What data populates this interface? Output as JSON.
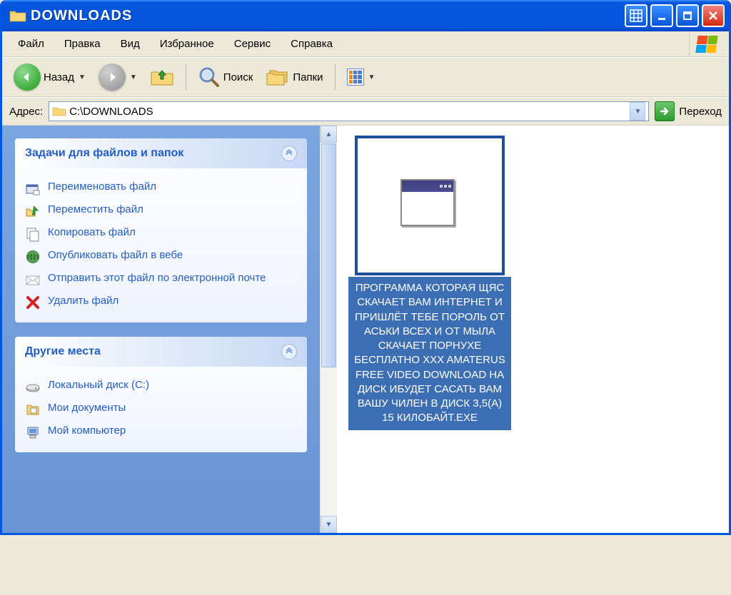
{
  "title": "DOWNLOADS",
  "menu": {
    "file": "Файл",
    "edit": "Правка",
    "view": "Вид",
    "favorites": "Избранное",
    "tools": "Сервис",
    "help": "Справка"
  },
  "toolbar": {
    "back": "Назад",
    "search": "Поиск",
    "folders": "Папки"
  },
  "address": {
    "label": "Адрес:",
    "value": "C:\\DOWNLOADS",
    "go_label": "Переход"
  },
  "sidebar": {
    "panel1": {
      "title": "Задачи для файлов и папок",
      "tasks": {
        "rename": "Переименовать файл",
        "move": "Переместить файл",
        "copy": "Копировать файл",
        "publish": "Опубликовать файл в вебе",
        "email": "Отправить этот файл по электронной почте",
        "delete": "Удалить файл"
      }
    },
    "panel2": {
      "title": "Другие места",
      "places": {
        "drive": "Локальный диск (C:)",
        "docs": "Мои документы",
        "computer": "Мой компьютер"
      }
    }
  },
  "file": {
    "name": "ПРОГРАММА КОТОРАЯ ЩЯС СКАЧАЕТ ВАМ ИНТЕРНЕТ И ПРИШЛЁТ ТЕБЕ ПОРОЛЬ ОТ АСЬКИ ВСЕХ И ОТ МЫЛА СКАЧАЕТ ПОРНУХЕ БЕСПЛАТНО XXX AMATERUS FREE VIDEO DOWNLOAD НА ДИСК ИБУДЕТ САСАТЬ ВАМ ВАШУ ЧИЛЕН В ДИСК 3,5(A) 15 КИЛОБАЙТ.EXE"
  }
}
